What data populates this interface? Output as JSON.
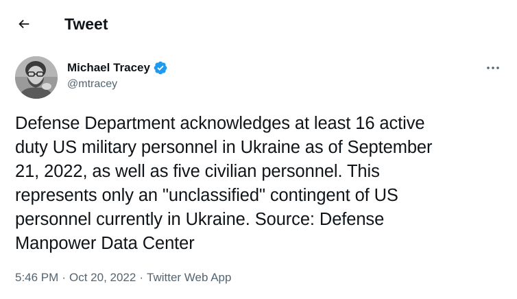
{
  "header": {
    "back_icon": "arrow-left-icon",
    "title": "Tweet"
  },
  "author": {
    "name": "Michael Tracey",
    "handle": "@mtracey",
    "verified_icon": "verified-badge-icon",
    "verified_color": "#1d9bf0"
  },
  "tweet": {
    "text": "Defense Department acknowledges at least 16 active\nduty US military personnel in Ukraine as of September\n21, 2022, as well as five civilian personnel. This\nrepresents only an \"unclassified\" contingent of US\npersonnel currently in Ukraine. Source: Defense\nManpower Data Center",
    "time": "5:46 PM",
    "date": "Oct 20, 2022",
    "source": "Twitter Web App",
    "separator": "·"
  },
  "more_icon": "more-horizontal-icon"
}
